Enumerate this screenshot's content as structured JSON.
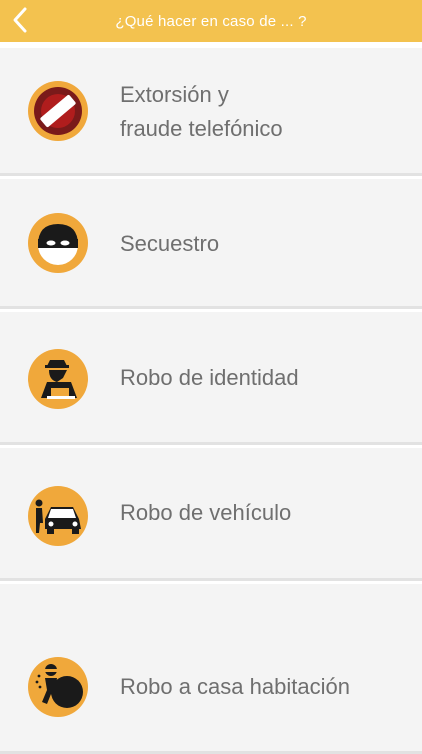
{
  "header": {
    "title": "¿Qué hacer en caso de ... ?",
    "back_icon": "chevron-left-icon"
  },
  "colors": {
    "accent": "#f3c24f",
    "card_bg": "#f4f4f4",
    "label_text": "#6f6f6f"
  },
  "items": [
    {
      "label_line1": "Extorsión y",
      "label_line2": "fraude telefónico",
      "icon": "prohibited-sign-icon"
    },
    {
      "label": "Secuestro",
      "icon": "masked-bandit-icon"
    },
    {
      "label": "Robo de identidad",
      "icon": "hacker-laptop-icon"
    },
    {
      "label": "Robo de vehículo",
      "icon": "car-thief-icon"
    },
    {
      "label": "Robo a casa habitación",
      "icon": "burglar-sack-icon"
    }
  ]
}
